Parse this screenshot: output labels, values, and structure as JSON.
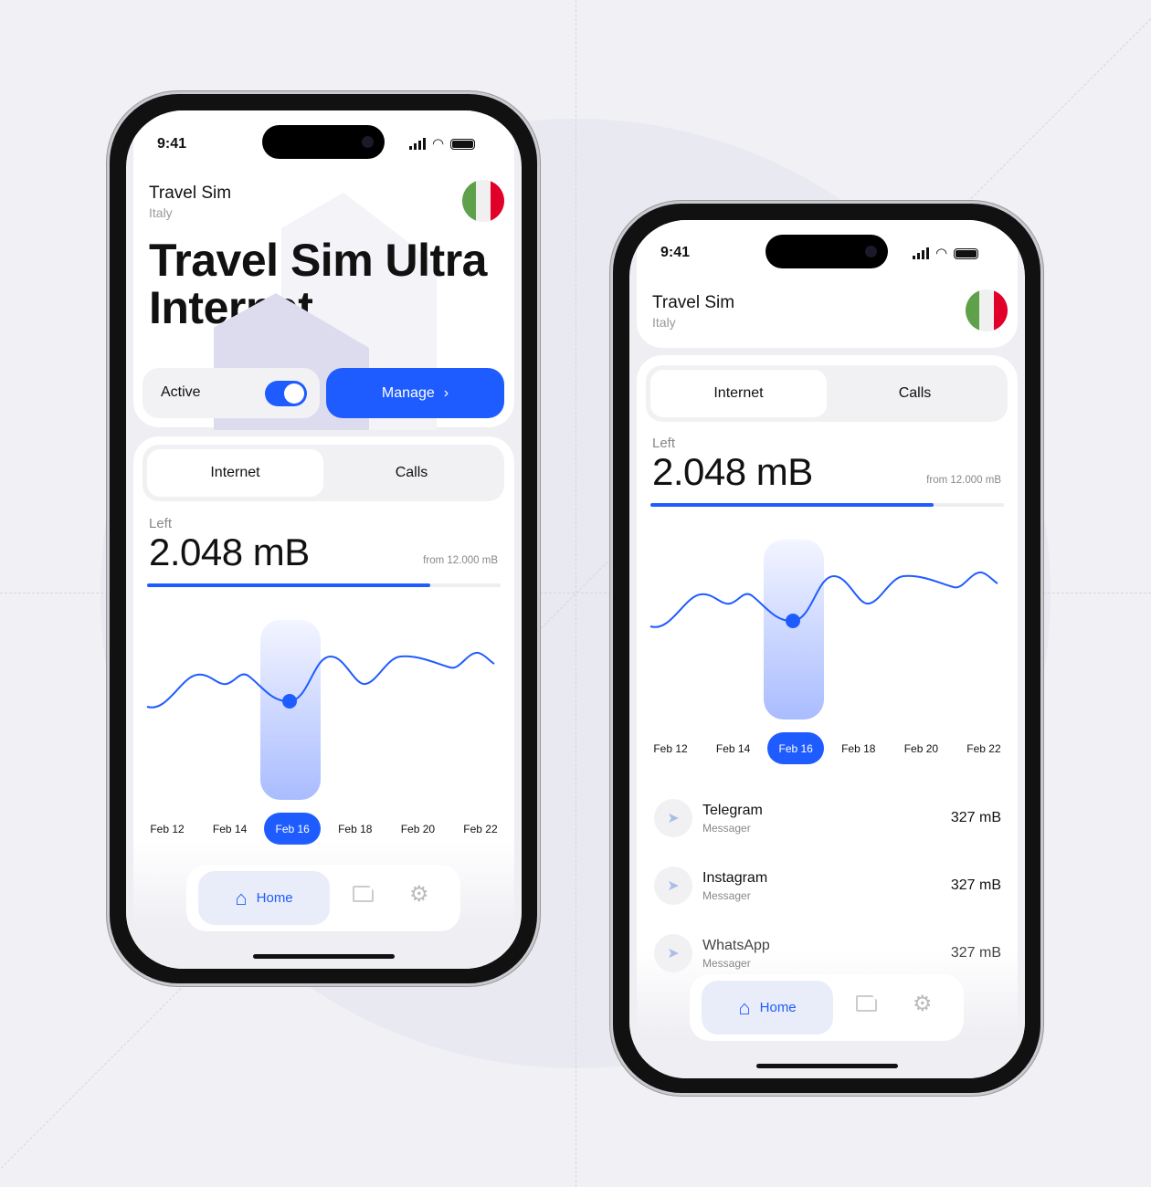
{
  "accent": "#1f5cff",
  "flag_colors": [
    "#5fa14a",
    "#f0f0f0",
    "#e0002a"
  ],
  "status": {
    "time": "9:41"
  },
  "header": {
    "title": "Travel Sim",
    "country": "Italy",
    "flag": "italy-flag"
  },
  "plan": {
    "name": "Travel Sim Ultra Internet",
    "active_label": "Active",
    "active": true,
    "manage_label": "Manage"
  },
  "tabs": [
    {
      "label": "Internet",
      "selected": true
    },
    {
      "label": "Calls",
      "selected": false
    }
  ],
  "usage": {
    "left_label": "Left",
    "amount": "2.048 mB",
    "from": "from 12.000 mB",
    "progress_percent": 80
  },
  "dates": [
    "Feb 12",
    "Feb 14",
    "Feb 16",
    "Feb 18",
    "Feb 20",
    "Feb 22"
  ],
  "selected_date": "Feb 16",
  "apps": [
    {
      "name": "Telegram",
      "category": "Messager",
      "usage": "327 mB",
      "icon": "paper-plane-icon"
    },
    {
      "name": "Instagram",
      "category": "Messager",
      "usage": "327 mB",
      "icon": "paper-plane-icon"
    },
    {
      "name": "WhatsApp",
      "category": "Messager",
      "usage": "327 mB",
      "icon": "paper-plane-icon"
    }
  ],
  "nav": {
    "home_label": "Home",
    "items": [
      "home-icon",
      "sim-card-icon",
      "gear-icon"
    ]
  }
}
